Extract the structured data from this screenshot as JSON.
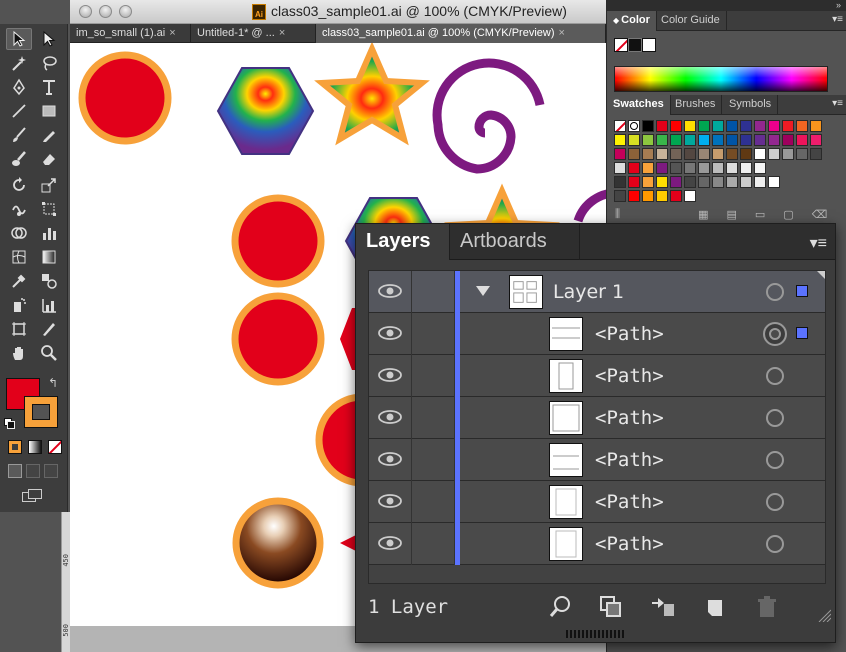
{
  "document": {
    "title": "class03_sample01.ai @ 100% (CMYK/Preview)",
    "badge": "Ai",
    "tabs": [
      {
        "label": "im_so_small (1).ai",
        "close": "×",
        "active": false
      },
      {
        "label": "Untitled-1* @ ...",
        "close": "×",
        "active": false
      },
      {
        "label": "class03_sample01.ai @ 100% (CMYK/Preview)",
        "close": "×",
        "active": true
      }
    ],
    "ruler_labels": [
      "450",
      "500"
    ]
  },
  "color_panel": {
    "tabs": [
      "Color",
      "Color Guide"
    ],
    "active_tab": "Color",
    "menu": "▾≡"
  },
  "swatch_panel": {
    "tabs": [
      "Swatches",
      "Brushes",
      "Symbols"
    ],
    "active_tab": "Swatches",
    "menu": "▾≡"
  },
  "layers_panel": {
    "tabs": [
      "Layers",
      "Artboards"
    ],
    "active_tab": "Layers",
    "menu": "▾≡",
    "layer": {
      "name": "Layer 1",
      "expanded": true
    },
    "paths": [
      {
        "name": "<Path>",
        "selected": true
      },
      {
        "name": "<Path>",
        "selected": false
      },
      {
        "name": "<Path>",
        "selected": false
      },
      {
        "name": "<Path>",
        "selected": false
      },
      {
        "name": "<Path>",
        "selected": false
      },
      {
        "name": "<Path>",
        "selected": false
      }
    ],
    "footer": "1 Layer"
  },
  "colors": {
    "fill": "#e2001a",
    "stroke": "#f7a13a",
    "purple": "#7d1a80",
    "selection_blue": "#5b73ff"
  }
}
